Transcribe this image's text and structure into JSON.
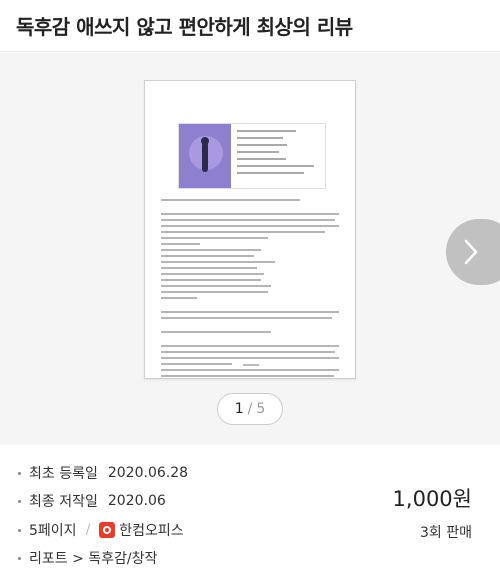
{
  "header": {
    "title": "독후감 애쓰지 않고 편안하게 최상의 리뷰"
  },
  "preview": {
    "pager": {
      "current": "1",
      "separator": "/",
      "total": "5"
    }
  },
  "icons": {
    "next": "chevron-right-icon",
    "app": "hancom-office-icon"
  },
  "info": {
    "registered_label": "최초 등록일",
    "registered_value": "2020.06.28",
    "created_label": "최종 저작일",
    "created_value": "2020.06",
    "pages": "5페이지",
    "app_name": "한컴오피스",
    "category": "리포트 > 독후감/창작",
    "price": "1,000원",
    "sales": "3회 판매"
  },
  "colors": {
    "app_icon": "#e83b2e",
    "cover": "#8f7fcf"
  }
}
